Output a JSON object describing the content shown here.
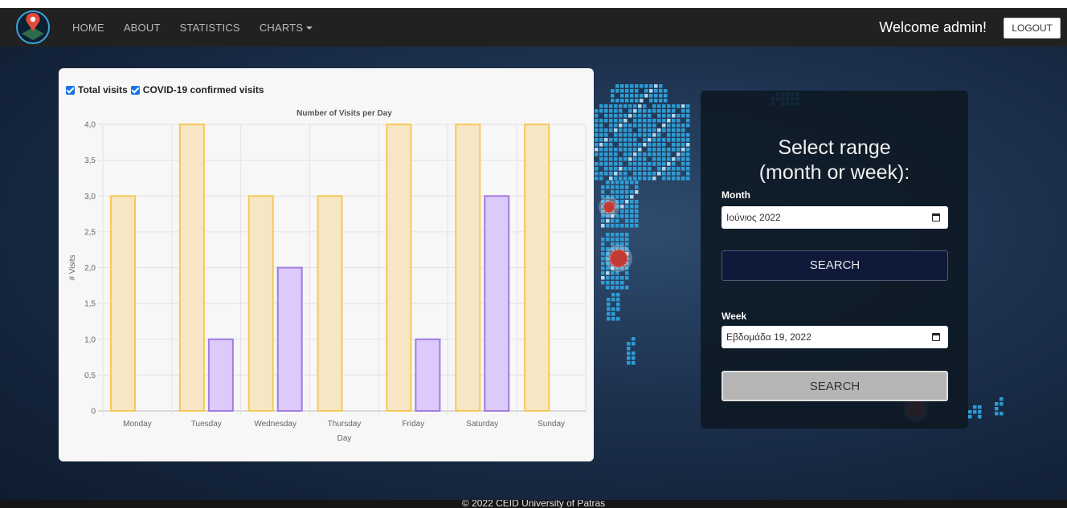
{
  "nav": {
    "links": [
      "HOME",
      "ABOUT",
      "STATISTICS",
      "CHARTS"
    ],
    "welcome": "Welcome admin!",
    "logout": "LOGOUT"
  },
  "legend_toggles": [
    {
      "label": "Total visits",
      "checked": true
    },
    {
      "label": "COVID-19 confirmed visits",
      "checked": true
    }
  ],
  "chart_data": {
    "type": "bar",
    "title": "Number of Visits per Day",
    "xlabel": "Day",
    "ylabel": "# Visits",
    "categories": [
      "Monday",
      "Tuesday",
      "Wednesday",
      "Thursday",
      "Friday",
      "Saturday",
      "Sunday"
    ],
    "ylim": [
      0,
      4
    ],
    "yticks": [
      "0",
      "0,5",
      "1,0",
      "1,5",
      "2,0",
      "2,5",
      "3,0",
      "3,5",
      "4,0"
    ],
    "grid": true,
    "series": [
      {
        "name": "Total visits",
        "values": [
          3,
          4,
          3,
          3,
          4,
          4,
          4
        ],
        "color": "#f7c85a",
        "fill": "#f7e6c3"
      },
      {
        "name": "COVID-19 confirmed visits",
        "values": [
          0,
          1,
          2,
          0,
          1,
          3,
          0
        ],
        "color": "#a27be0",
        "fill": "#dccafa"
      }
    ]
  },
  "range": {
    "title_line1": "Select range",
    "title_line2": "(month or week):",
    "month_label": "Month",
    "month_value": "Ιούνιος 2022",
    "week_label": "Week",
    "week_value": "Εβδομάδα 19, 2022",
    "search_label": "SEARCH"
  },
  "footer": "© 2022  CEID  University of Patras"
}
